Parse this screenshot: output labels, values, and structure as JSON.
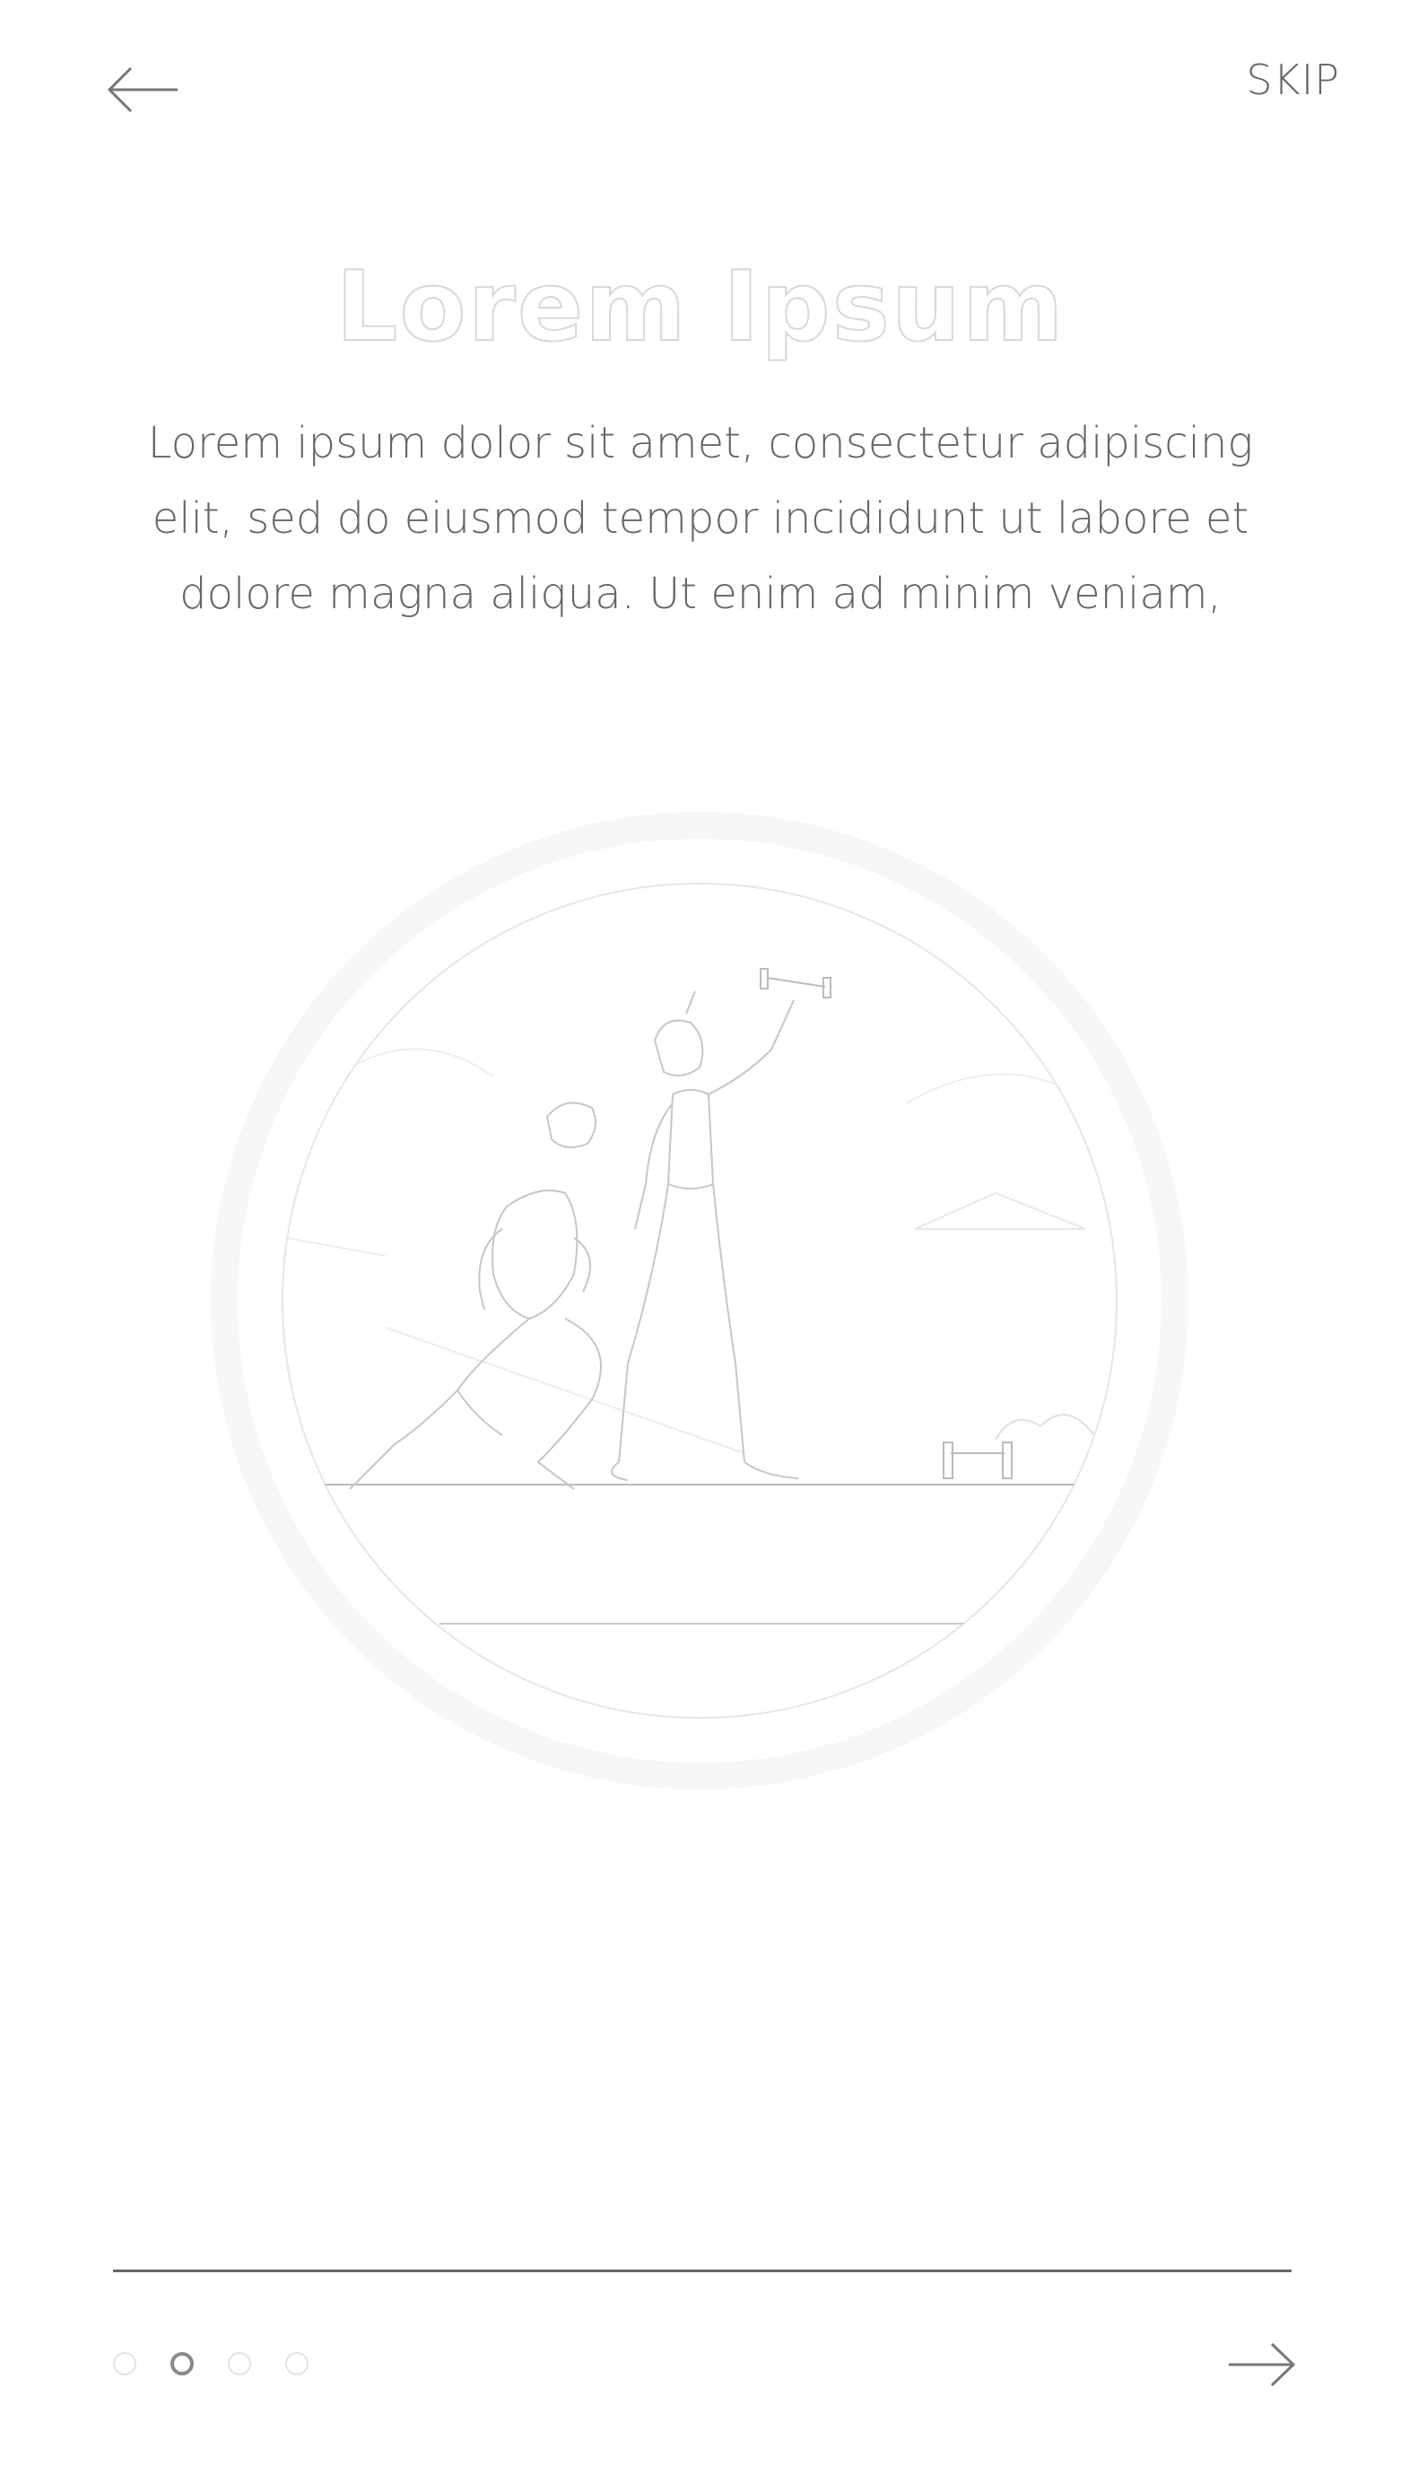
{
  "header": {
    "back_icon": "arrow-left-icon",
    "skip_label": "SKIP"
  },
  "content": {
    "title": "Lorem Ipsum",
    "description": "Lorem ipsum dolor sit amet, consectetur adipiscing elit, sed do eiusmod tempor incididunt ut labore et dolore magna aliqua. Ut enim ad minim veniam,",
    "illustration": "fitness-illustration"
  },
  "footer": {
    "pager": {
      "total": 4,
      "active_index": 1
    },
    "next_icon": "arrow-right-icon"
  },
  "colors": {
    "text": "#666666",
    "title_outline": "#d8d8d8",
    "divider": "#666666",
    "dot_inactive": "#e3e3e3",
    "dot_active": "#8a8a8a"
  }
}
